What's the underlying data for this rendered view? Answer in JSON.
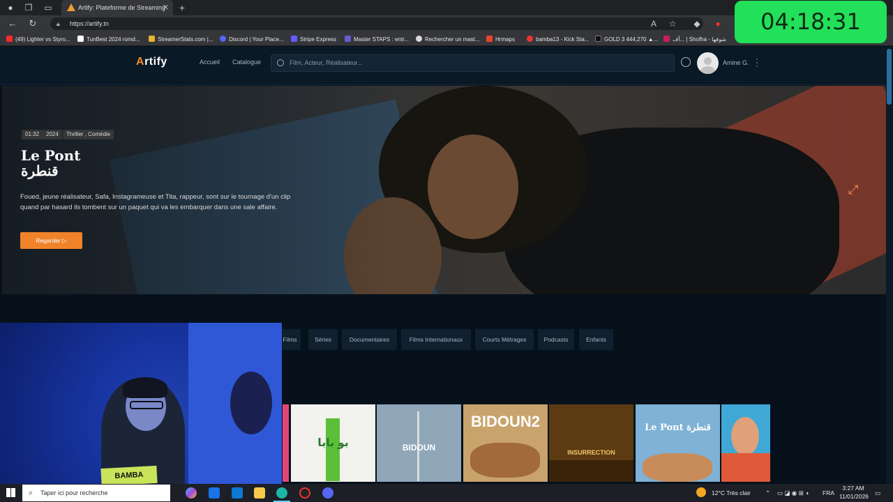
{
  "browser": {
    "tab_title": "Artify: Plateforme de Streaming",
    "tab_close": "✕",
    "new_tab": "+",
    "url": "https://artify.tn",
    "timer": "04:18:31"
  },
  "bookmarks": [
    {
      "label": "(49) Lighter vs Styro...",
      "color": "#ff2a2a"
    },
    {
      "label": "TunBest 2024 romd...",
      "color": "#ffffff"
    },
    {
      "label": "StreamerStats.com |...",
      "color": "#e4b42a"
    },
    {
      "label": "Discord | Your Place...",
      "color": "#5865f2"
    },
    {
      "label": "Stripe Express",
      "color": "#635bff"
    },
    {
      "label": "Master STAPS : entr...",
      "color": "#6a5acd"
    },
    {
      "label": "Rechercher un mast...",
      "color": "#d9d9d9"
    },
    {
      "label": "Hrmaps",
      "color": "#e8452c"
    },
    {
      "label": "bamba13 - Kick Sta...",
      "color": "#e33"
    },
    {
      "label": "GOLD 3 444,270 ▲...",
      "color": "#111111"
    },
    {
      "label": "أف... | Shofha - شوفها",
      "color": "#c81e5a"
    }
  ],
  "site": {
    "logo_a": "A",
    "logo_rest": "rtify",
    "nav": [
      "Accueil",
      "Catalogue"
    ],
    "search_placeholder": "Film, Acteur, Réalisateur...",
    "user_name": "Amine G."
  },
  "hero": {
    "chips": [
      "01:32",
      "2024",
      "Thriller , Comédie"
    ],
    "title_line1": "Le Pont",
    "title_line2": "قنطرة",
    "synopsis": "Foued, jeune réalisateur, Safa, Instagrameuse et Tita, rappeur, sont sur le tournage d'un clip quand par hasard ils tombent sur un paquet qui va les embarquer dans une sale affaire.",
    "watch_button": "Regarder ▷"
  },
  "categories": [
    "Films",
    "Séries",
    "Documentaires",
    "Films Internationaux",
    "Courts Métrages",
    "Podcasts",
    "Enfants"
  ],
  "posters": [
    {
      "text": "بو بابا",
      "bg": "#f2f2ee",
      "fg": "#2c7a2c"
    },
    {
      "text": "BIDOUN",
      "bg": "#8fa7b8",
      "fg": "#ffffff"
    },
    {
      "text": "BIDOUN2",
      "bg": "#c9a36c",
      "fg": "#ffffff"
    },
    {
      "text": "INSURRECTION",
      "bg": "#5c3a12",
      "fg": "#f2c66b"
    },
    {
      "text": "Le Pont قنطرة",
      "bg": "#7fb2d6",
      "fg": "#ffffff"
    },
    {
      "text": "",
      "bg": "#3fa8d6",
      "fg": "#ffffff"
    }
  ],
  "webcam": {
    "sticker": "BAMBA"
  },
  "taskbar": {
    "search_placeholder": "Taper ici pour recherche",
    "weather": "12°C  Très clair",
    "language": "FRA",
    "time": "3:27 AM",
    "date": "11/01/2026"
  },
  "colors": {
    "accent": "#f0832a",
    "page_bg": "#06111c",
    "timer_bg": "#22e05a"
  }
}
